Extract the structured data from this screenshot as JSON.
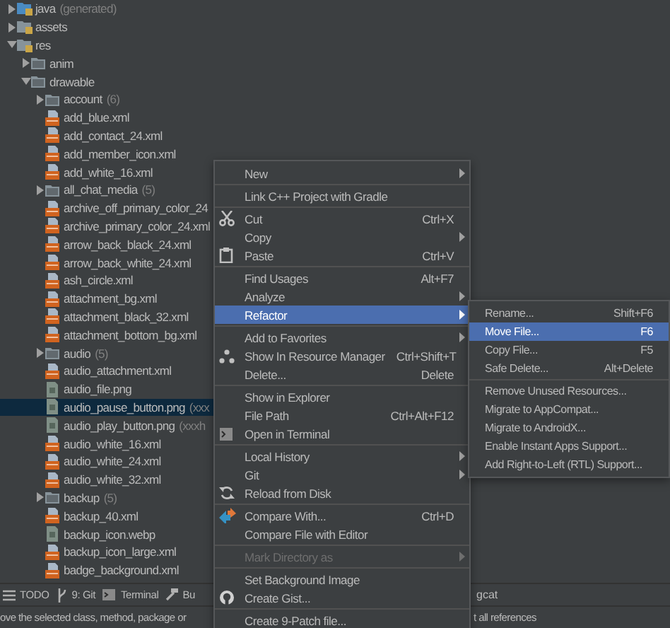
{
  "tree": [
    {
      "label": "java",
      "hint": "(generated)",
      "kind": "source-root",
      "expanded": false
    },
    {
      "label": "assets",
      "kind": "resource-root",
      "expanded": false
    },
    {
      "label": "res",
      "kind": "resource-root",
      "expanded": true,
      "children": [
        {
          "label": "anim",
          "kind": "folder",
          "expanded": false
        },
        {
          "label": "drawable",
          "kind": "folder",
          "expanded": true,
          "children": [
            {
              "label": "account",
              "hint": "(6)",
              "kind": "folder",
              "expanded": false
            },
            {
              "label": "add_blue.xml",
              "kind": "xml",
              "selected": false
            },
            {
              "label": "add_contact_24.xml",
              "kind": "xml",
              "selected": false
            },
            {
              "label": "add_member_icon.xml",
              "kind": "xml",
              "selected": false
            },
            {
              "label": "add_white_16.xml",
              "kind": "xml",
              "selected": false
            },
            {
              "label": "all_chat_media",
              "hint": "(5)",
              "kind": "folder",
              "expanded": false
            },
            {
              "label": "archive_off_primary_color_24",
              "kind": "xml",
              "selected": false
            },
            {
              "label": "archive_primary_color_24.xml",
              "kind": "xml",
              "selected": false
            },
            {
              "label": "arrow_back_black_24.xml",
              "kind": "xml",
              "selected": false
            },
            {
              "label": "arrow_back_white_24.xml",
              "kind": "xml",
              "selected": false
            },
            {
              "label": "ash_circle.xml",
              "kind": "xml",
              "selected": false
            },
            {
              "label": "attachment_bg.xml",
              "kind": "xml",
              "selected": false
            },
            {
              "label": "attachment_black_32.xml",
              "kind": "xml",
              "selected": false
            },
            {
              "label": "attachment_bottom_bg.xml",
              "kind": "xml",
              "selected": false
            },
            {
              "label": "audio",
              "hint": "(5)",
              "kind": "folder",
              "expanded": false
            },
            {
              "label": "audio_attachment.xml",
              "kind": "xml",
              "selected": false
            },
            {
              "label": "audio_file.png",
              "kind": "image",
              "selected": false
            },
            {
              "label": "audio_pause_button.png",
              "hint": "(xxx",
              "kind": "image",
              "selected": true
            },
            {
              "label": "audio_play_button.png",
              "hint": "(xxxh",
              "kind": "image",
              "selected": false
            },
            {
              "label": "audio_white_16.xml",
              "kind": "xml",
              "selected": false
            },
            {
              "label": "audio_white_24.xml",
              "kind": "xml",
              "selected": false
            },
            {
              "label": "audio_white_32.xml",
              "kind": "xml",
              "selected": false
            },
            {
              "label": "backup",
              "hint": "(5)",
              "kind": "folder",
              "expanded": false
            },
            {
              "label": "backup_40.xml",
              "kind": "xml",
              "selected": false
            },
            {
              "label": "backup_icon.webp",
              "kind": "image",
              "selected": false
            },
            {
              "label": "backup_icon_large.xml",
              "kind": "xml",
              "selected": false
            },
            {
              "label": "badge_background.xml",
              "kind": "xml",
              "selected": false
            }
          ]
        }
      ]
    }
  ],
  "menu": {
    "items": [
      {
        "kind": "item",
        "label": "New",
        "submenu": true,
        "selected": false,
        "disabled": false
      },
      {
        "kind": "separator"
      },
      {
        "kind": "item",
        "label": "Link C++ Project with Gradle",
        "submenu": false,
        "selected": false,
        "disabled": false
      },
      {
        "kind": "separator"
      },
      {
        "kind": "item",
        "label": "Cut",
        "shortcut": "Ctrl+X",
        "submenu": false,
        "selected": false,
        "disabled": false
      },
      {
        "kind": "item",
        "label": "Copy",
        "submenu": true,
        "selected": false,
        "disabled": false
      },
      {
        "kind": "item",
        "label": "Paste",
        "shortcut": "Ctrl+V",
        "submenu": false,
        "selected": false,
        "disabled": false
      },
      {
        "kind": "separator"
      },
      {
        "kind": "item",
        "label": "Find Usages",
        "shortcut": "Alt+F7",
        "submenu": false,
        "selected": false,
        "disabled": false
      },
      {
        "kind": "item",
        "label": "Analyze",
        "submenu": true,
        "selected": false,
        "disabled": false
      },
      {
        "kind": "item",
        "label": "Refactor",
        "submenu": true,
        "selected": true,
        "disabled": false
      },
      {
        "kind": "separator"
      },
      {
        "kind": "item",
        "label": "Add to Favorites",
        "submenu": true,
        "selected": false,
        "disabled": false
      },
      {
        "kind": "item",
        "label": "Show In Resource Manager",
        "shortcut": "Ctrl+Shift+T",
        "submenu": false,
        "selected": false,
        "disabled": false
      },
      {
        "kind": "item",
        "label": "Delete...",
        "shortcut": "Delete",
        "submenu": false,
        "selected": false,
        "disabled": false
      },
      {
        "kind": "separator"
      },
      {
        "kind": "item",
        "label": "Show in Explorer",
        "submenu": false,
        "selected": false,
        "disabled": false
      },
      {
        "kind": "item",
        "label": "File Path",
        "shortcut": "Ctrl+Alt+F12",
        "submenu": false,
        "selected": false,
        "disabled": false
      },
      {
        "kind": "item",
        "label": "Open in Terminal",
        "submenu": false,
        "selected": false,
        "disabled": false
      },
      {
        "kind": "separator"
      },
      {
        "kind": "item",
        "label": "Local History",
        "submenu": true,
        "selected": false,
        "disabled": false
      },
      {
        "kind": "item",
        "label": "Git",
        "submenu": true,
        "selected": false,
        "disabled": false
      },
      {
        "kind": "item",
        "label": "Reload from Disk",
        "submenu": false,
        "selected": false,
        "disabled": false
      },
      {
        "kind": "separator"
      },
      {
        "kind": "item",
        "label": "Compare With...",
        "shortcut": "Ctrl+D",
        "submenu": false,
        "selected": false,
        "disabled": false
      },
      {
        "kind": "item",
        "label": "Compare File with Editor",
        "submenu": false,
        "selected": false,
        "disabled": false
      },
      {
        "kind": "separator"
      },
      {
        "kind": "item",
        "label": "Mark Directory as",
        "submenu": true,
        "selected": false,
        "disabled": true
      },
      {
        "kind": "separator"
      },
      {
        "kind": "item",
        "label": "Set Background Image",
        "submenu": false,
        "selected": false,
        "disabled": false
      },
      {
        "kind": "item",
        "label": "Create Gist...",
        "submenu": false,
        "selected": false,
        "disabled": false
      },
      {
        "kind": "separator"
      },
      {
        "kind": "item",
        "label": "Create 9-Patch file...",
        "submenu": false,
        "selected": false,
        "disabled": false
      }
    ]
  },
  "submenu": {
    "items": [
      {
        "kind": "item",
        "label": "Rename...",
        "shortcut": "Shift+F6",
        "submenu": false,
        "selected": false,
        "disabled": false
      },
      {
        "kind": "item",
        "label": "Move File...",
        "shortcut": "F6",
        "submenu": false,
        "selected": true,
        "disabled": false
      },
      {
        "kind": "item",
        "label": "Copy File...",
        "shortcut": "F5",
        "submenu": false,
        "selected": false,
        "disabled": false
      },
      {
        "kind": "item",
        "label": "Safe Delete...",
        "shortcut": "Alt+Delete",
        "submenu": false,
        "selected": false,
        "disabled": false
      },
      {
        "kind": "separator"
      },
      {
        "kind": "item",
        "label": "Remove Unused Resources...",
        "submenu": false,
        "selected": false,
        "disabled": false
      },
      {
        "kind": "item",
        "label": "Migrate to AppCompat...",
        "submenu": false,
        "selected": false,
        "disabled": false
      },
      {
        "kind": "item",
        "label": "Migrate to AndroidX...",
        "submenu": false,
        "selected": false,
        "disabled": false
      },
      {
        "kind": "item",
        "label": "Enable Instant Apps Support...",
        "submenu": false,
        "selected": false,
        "disabled": false
      },
      {
        "kind": "item",
        "label": "Add Right-to-Left (RTL) Support...",
        "submenu": false,
        "selected": false,
        "disabled": false
      }
    ]
  },
  "tool_bar": {
    "left": [
      {
        "label": "TODO",
        "kind": "todo"
      },
      {
        "label": "9: Git",
        "kind": "git"
      },
      {
        "label": "Terminal",
        "kind": "terminal"
      },
      {
        "label": "Bu",
        "kind": "build"
      }
    ],
    "right": [
      {
        "label": "gcat"
      }
    ]
  },
  "status_bar": {
    "left": "ove the selected class, method, package or",
    "right": "t all references"
  }
}
